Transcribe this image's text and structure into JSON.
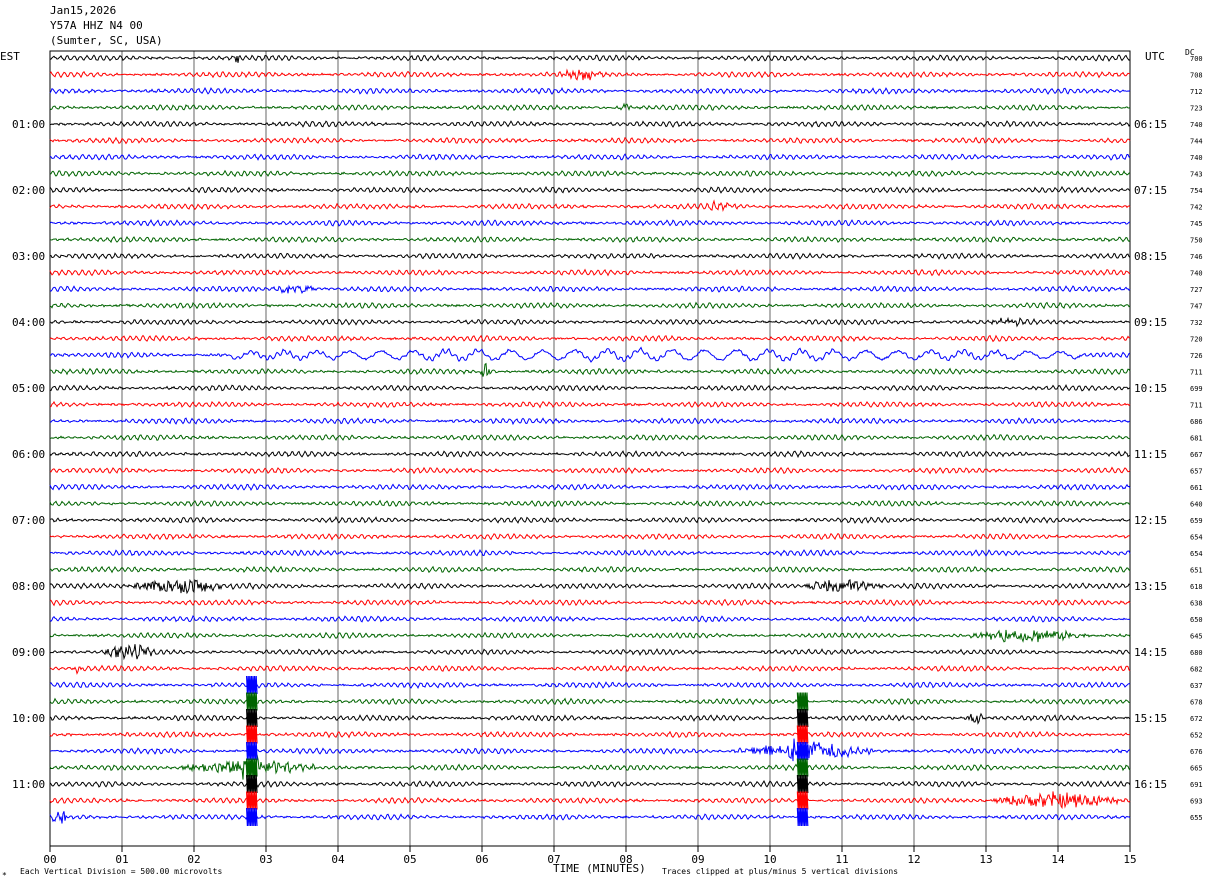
{
  "header": {
    "date": "Jan15,2026",
    "station": "Y57A HHZ N4 00",
    "location": "(Sumter, SC, USA)"
  },
  "left_tz": "EST",
  "right_tz": "UTC",
  "dc_label": "DC",
  "footer": {
    "scale_note": "Each Vertical Division =  500.00 microvolts",
    "clip_note": "Traces clipped at plus/minus 5 vertical divisions",
    "corner_mark": "*"
  },
  "colors": {
    "trace_cycle": [
      "#000000",
      "#ff0000",
      "#0000ff",
      "#006400"
    ],
    "grid": "#000000"
  },
  "chart_data": {
    "type": "line",
    "xlabel": "TIME (MINUTES)",
    "x_ticks": [
      "00",
      "01",
      "02",
      "03",
      "04",
      "05",
      "06",
      "07",
      "08",
      "09",
      "10",
      "11",
      "12",
      "13",
      "14",
      "15"
    ],
    "xlim": [
      0,
      15
    ],
    "row_count": 48,
    "left_hour_labels": [
      "01:00",
      "02:00",
      "03:00",
      "04:00",
      "05:00",
      "06:00",
      "07:00",
      "08:00",
      "09:00",
      "10:00",
      "11:00"
    ],
    "right_hour_labels": [
      "06:15",
      "07:15",
      "08:15",
      "09:15",
      "10:15",
      "11:15",
      "12:15",
      "13:15",
      "14:15",
      "15:15",
      "16:15"
    ],
    "hour_label_rows": [
      4,
      8,
      12,
      16,
      20,
      24,
      28,
      32,
      36,
      40,
      44
    ],
    "dc_values": [
      "700",
      "708",
      "712",
      "723",
      "740",
      "744",
      "740",
      "743",
      "754",
      "742",
      "745",
      "750",
      "746",
      "740",
      "727",
      "747",
      "732",
      "720",
      "726",
      "711",
      "699",
      "711",
      "686",
      "681",
      "667",
      "657",
      "661",
      "640",
      "659",
      "654",
      "654",
      "651",
      "618",
      "638",
      "650",
      "645",
      "680",
      "682",
      "637",
      "678",
      "672",
      "652",
      "676",
      "665",
      "691",
      "693",
      "655"
    ],
    "events": [
      {
        "row": 0,
        "start": 2.55,
        "end": 2.65,
        "amp": 2.2
      },
      {
        "row": 1,
        "start": 7.0,
        "end": 7.8,
        "amp": 1.3
      },
      {
        "row": 3,
        "start": 7.9,
        "end": 8.1,
        "amp": 1.2
      },
      {
        "row": 9,
        "start": 9.0,
        "end": 9.6,
        "amp": 1.2
      },
      {
        "row": 14,
        "start": 3.0,
        "end": 3.8,
        "amp": 1.2
      },
      {
        "row": 16,
        "start": 13.0,
        "end": 13.6,
        "amp": 1.1
      },
      {
        "row": 18,
        "start": 2.5,
        "end": 14.3,
        "amp": 1.6,
        "slow": true
      },
      {
        "row": 19,
        "start": 5.95,
        "end": 6.15,
        "amp": 2.5
      },
      {
        "row": 32,
        "start": 1.0,
        "end": 2.6,
        "amp": 2.2
      },
      {
        "row": 32,
        "start": 10.4,
        "end": 11.6,
        "amp": 2.4
      },
      {
        "row": 35,
        "start": 12.7,
        "end": 14.5,
        "amp": 2.0
      },
      {
        "row": 36,
        "start": 0.7,
        "end": 1.5,
        "amp": 2.0
      },
      {
        "row": 37,
        "start": 0.3,
        "end": 0.5,
        "amp": 2.0
      },
      {
        "row": 40,
        "start": 12.7,
        "end": 13.0,
        "amp": 1.8
      },
      {
        "row": 42,
        "start": 9.4,
        "end": 11.6,
        "amp": 2.2
      },
      {
        "row": 42,
        "start": 10.2,
        "end": 10.7,
        "amp": 3.0
      },
      {
        "row": 43,
        "start": 1.7,
        "end": 3.8,
        "amp": 2.2
      },
      {
        "row": 43,
        "start": 2.6,
        "end": 3.0,
        "amp": 4.0
      },
      {
        "row": 45,
        "start": 13.0,
        "end": 15.0,
        "amp": 2.4
      },
      {
        "row": 46,
        "start": 0.0,
        "end": 0.3,
        "amp": 2.0
      }
    ],
    "clipped_spikes": [
      {
        "row_start": 38,
        "row_end": 47,
        "x": 2.8
      },
      {
        "row_start": 39,
        "row_end": 46,
        "x": 10.45
      }
    ]
  }
}
